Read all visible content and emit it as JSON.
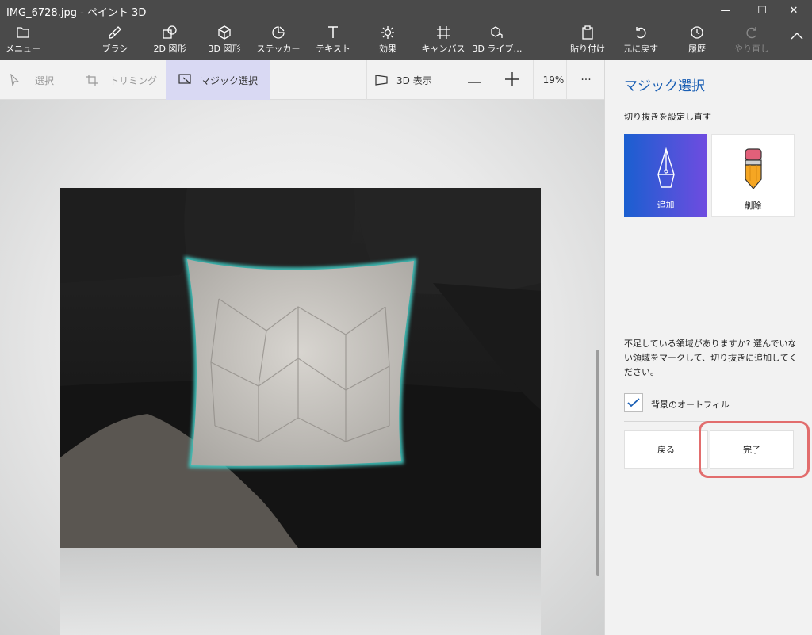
{
  "window": {
    "title": "IMG_6728.jpg - ペイント 3D",
    "min_symbol": "—",
    "max_symbol": "☐",
    "close_symbol": "✕"
  },
  "ribbon": {
    "menu": "メニュー",
    "brush": "ブラシ",
    "shapes2d": "2D 図形",
    "shapes3d": "3D 図形",
    "stickers": "ステッカー",
    "text": "テキスト",
    "effects": "効果",
    "canvas": "キャンバス",
    "library3d": "3D ライブ…",
    "paste": "貼り付け",
    "undo": "元に戻す",
    "history": "履歴",
    "redo": "やり直し"
  },
  "toolbar": {
    "select": "選択",
    "crop": "トリミング",
    "magic_select": "マジック選択",
    "view3d": "3D 表示",
    "zoom": "19%",
    "more": "···"
  },
  "panel": {
    "title": "マジック選択",
    "subtitle": "切り抜きを設定し直す",
    "add_label": "追加",
    "remove_label": "削除",
    "hint": "不足している領域がありますか? 選んでいない領域をマークして、切り抜きに追加してください。",
    "autofill_label": "背景のオートフィル",
    "autofill_checked": true,
    "back_label": "戻る",
    "done_label": "完了"
  },
  "colors": {
    "chrome": "#4a4a4a",
    "accent": "#1a5fb4",
    "add_gradient_start": "#1a5fd0",
    "add_gradient_end": "#6f4ce0",
    "highlight": "#e26d6d",
    "selection_glow": "#3fc7c0"
  }
}
